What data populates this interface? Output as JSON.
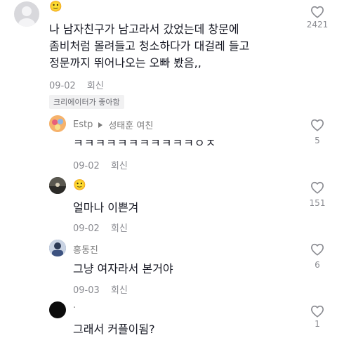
{
  "comments": [
    {
      "user": "",
      "emoji": "🙂",
      "text_lines": [
        "나 남자친구가 남고라서 갔었는데 창문에",
        "좀비처럼 몰려들고 청소하다가 대걸레 들고",
        "정문까지 뛰어나오는 오빠 봤음,,"
      ],
      "date": "09-02",
      "reply": "회신",
      "likes": "2421",
      "badge": "크리에이터가 좋아함"
    },
    {
      "user": "Estp",
      "reply_to": "성태훈 여친",
      "text": "ㅋㅋㅋㅋㅋㅋㅋㅋㅋㅋㅋㅇㅈ",
      "date": "09-02",
      "reply": "회신",
      "likes": "5"
    },
    {
      "user": "",
      "emoji": "🙂",
      "text": "얼마나 이쁜겨",
      "date": "09-02",
      "reply": "회신",
      "likes": "151"
    },
    {
      "user": "홍동진",
      "text": "그냥 여자라서 본거야",
      "date": "09-03",
      "reply": "회신",
      "likes": "6"
    },
    {
      "user": "·",
      "text": "그래서 커플이됨?",
      "likes": "1"
    }
  ],
  "icons": {
    "like": "heart-outline-icon",
    "reply_arrow": "triangle-right-icon"
  }
}
